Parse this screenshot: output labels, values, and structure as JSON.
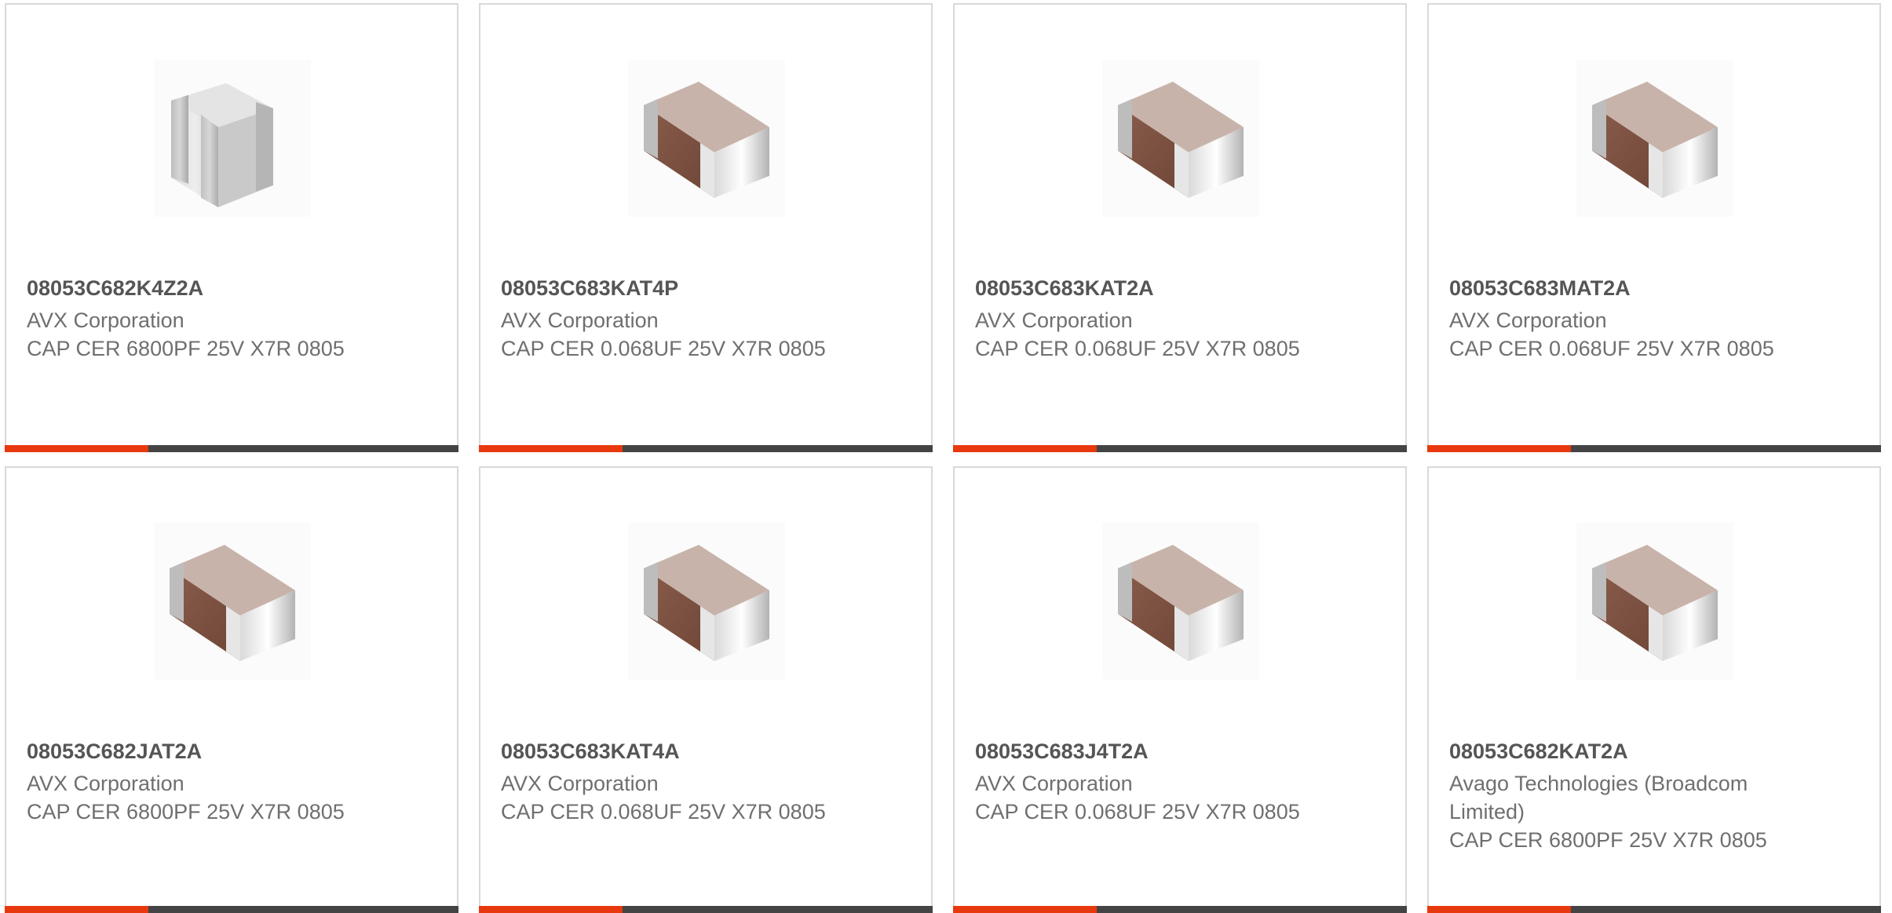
{
  "accent_color": "#e8380d",
  "bar_color": "#444444",
  "products": [
    {
      "part_number": "08053C682K4Z2A",
      "manufacturer": "AVX Corporation",
      "description": "CAP CER 6800PF 25V X7R 0805",
      "image_icon": "gray-ceramic-capacitor-icon"
    },
    {
      "part_number": "08053C683KAT4P",
      "manufacturer": "AVX Corporation",
      "description": "CAP CER 0.068UF 25V X7R 0805",
      "image_icon": "brown-ceramic-capacitor-icon"
    },
    {
      "part_number": "08053C683KAT2A",
      "manufacturer": "AVX Corporation",
      "description": "CAP CER 0.068UF 25V X7R 0805",
      "image_icon": "brown-ceramic-capacitor-icon"
    },
    {
      "part_number": "08053C683MAT2A",
      "manufacturer": "AVX Corporation",
      "description": "CAP CER 0.068UF 25V X7R 0805",
      "image_icon": "brown-ceramic-capacitor-icon"
    },
    {
      "part_number": "08053C682JAT2A",
      "manufacturer": "AVX Corporation",
      "description": "CAP CER 6800PF 25V X7R 0805",
      "image_icon": "brown-ceramic-capacitor-icon"
    },
    {
      "part_number": "08053C683KAT4A",
      "manufacturer": "AVX Corporation",
      "description": "CAP CER 0.068UF 25V X7R 0805",
      "image_icon": "brown-ceramic-capacitor-icon"
    },
    {
      "part_number": "08053C683J4T2A",
      "manufacturer": "AVX Corporation",
      "description": "CAP CER 0.068UF 25V X7R 0805",
      "image_icon": "brown-ceramic-capacitor-icon"
    },
    {
      "part_number": "08053C682KAT2A",
      "manufacturer": "Avago Technologies (Broadcom Limited)",
      "description": "CAP CER 6800PF 25V X7R 0805",
      "image_icon": "brown-ceramic-capacitor-icon"
    }
  ]
}
